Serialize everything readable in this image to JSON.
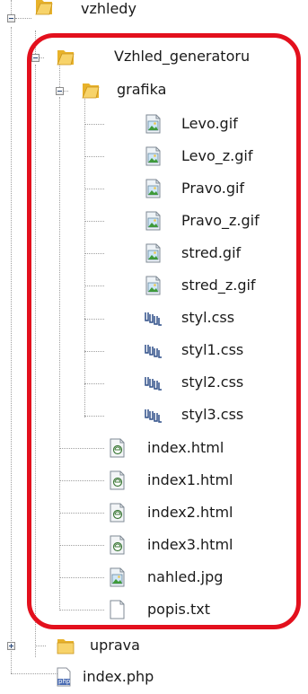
{
  "window": {
    "title": ""
  },
  "colors": {
    "highlight": "#e3101d",
    "folder": "#f2c12e",
    "guide": "#a0a0a0"
  },
  "tree": {
    "root_label": "vzhledy",
    "folder": "Vzhled_generatoru",
    "subfolder": "grafika",
    "grafika_items": [
      {
        "label": "Levo.gif",
        "icon": "image-file-icon"
      },
      {
        "label": "Levo_z.gif",
        "icon": "image-file-icon"
      },
      {
        "label": "Pravo.gif",
        "icon": "image-file-icon"
      },
      {
        "label": "Pravo_z.gif",
        "icon": "image-file-icon"
      },
      {
        "label": "stred.gif",
        "icon": "image-file-icon"
      },
      {
        "label": "stred_z.gif",
        "icon": "image-file-icon"
      },
      {
        "label": "styl.css",
        "icon": "css-file-icon"
      },
      {
        "label": "styl1.css",
        "icon": "css-file-icon"
      },
      {
        "label": "styl2.css",
        "icon": "css-file-icon"
      },
      {
        "label": "styl3.css",
        "icon": "css-file-icon"
      }
    ],
    "folder_items": [
      {
        "label": "index.html",
        "icon": "html-file-icon"
      },
      {
        "label": "index1.html",
        "icon": "html-file-icon"
      },
      {
        "label": "index2.html",
        "icon": "html-file-icon"
      },
      {
        "label": "index3.html",
        "icon": "html-file-icon"
      },
      {
        "label": "nahled.jpg",
        "icon": "image-file-icon"
      },
      {
        "label": "popis.txt",
        "icon": "text-file-icon"
      }
    ],
    "sibling_folder": "uprava",
    "root_file": "index.php",
    "php_badge": "php"
  }
}
